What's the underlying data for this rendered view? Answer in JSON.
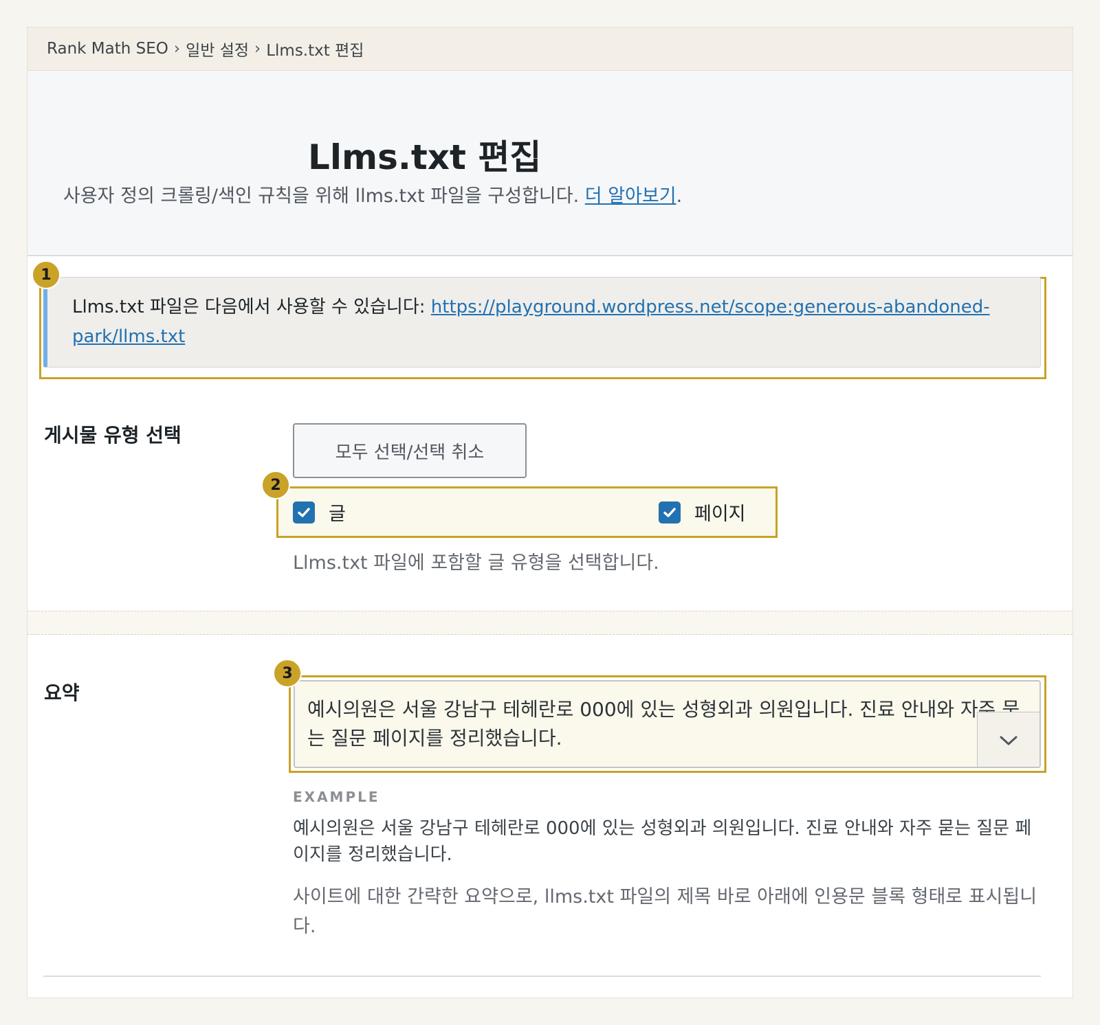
{
  "breadcrumb": {
    "items": [
      "Rank Math SEO",
      "일반 설정",
      "Llms.txt 편집"
    ],
    "separator": "›"
  },
  "header": {
    "title": "Llms.txt 편집",
    "description": "사용자 정의 크롤링/색인 규칙을 위해 llms.txt 파일을 구성합니다.",
    "learn_more": "더 알아보기",
    "learn_more_suffix": "."
  },
  "markers": [
    "1",
    "2",
    "3"
  ],
  "notice": {
    "text": "Llms.txt 파일은 다음에서 사용할 수 있습니다:",
    "link": "https://playground.wordpress.net/scope:generous-abandoned-park/llms.txt"
  },
  "post_types": {
    "label": "게시물 유형 선택",
    "select_all_button": "모두 선택/선택 취소",
    "options": [
      {
        "label": "글",
        "checked": true
      },
      {
        "label": "페이지",
        "checked": true
      }
    ],
    "help": "Llms.txt 파일에 포함할 글 유형을 선택합니다."
  },
  "summary": {
    "label": "요약",
    "value": "예시의원은 서울 강남구 테헤란로 000에 있는 성형외과 의원입니다. 진료 안내와 자주 묻는 질문 페이지를 정리했습니다.",
    "example_label": "EXAMPLE",
    "example_text": "예시의원은 서울 강남구 테헤란로 000에 있는 성형외과 의원입니다. 진료 안내와 자주 묻는 질문 페이지를 정리했습니다.",
    "help": "사이트에 대한 간략한 요약으로, llms.txt 파일의 제목 바로 아래에 인용문 블록 형태로 표시됩니다."
  },
  "icons": {
    "checkbox": "checkbox-checked-icon",
    "expand": "chevron-down-icon"
  },
  "colors": {
    "accent": "#2271b1",
    "highlight": "#c9a227",
    "notice_border": "#72aee6"
  }
}
